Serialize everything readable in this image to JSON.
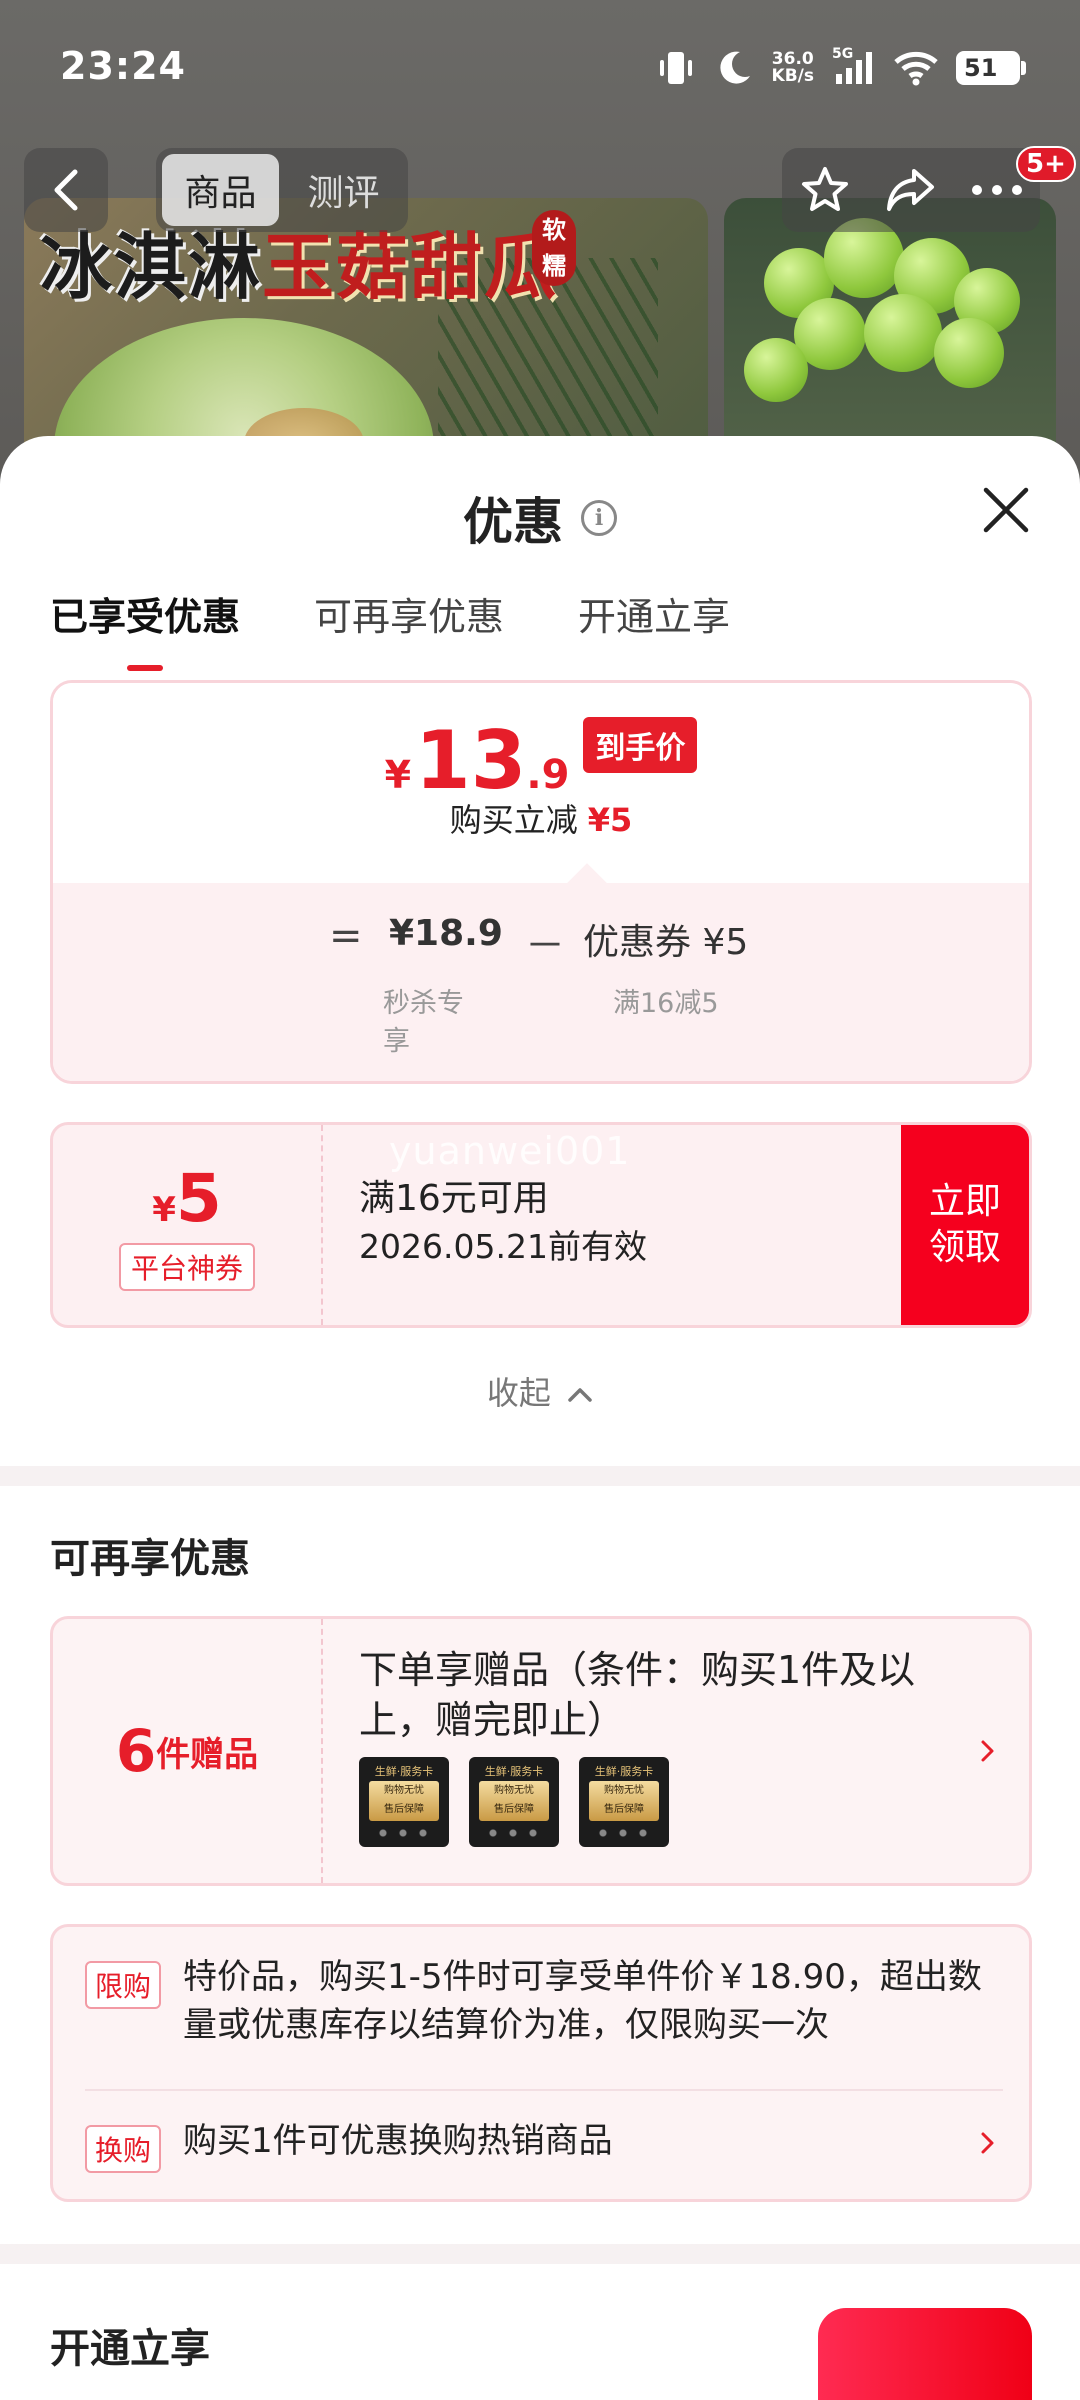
{
  "status": {
    "time": "23:24",
    "net_speed_value": "36.0",
    "net_speed_unit": "KB/s",
    "signal_label": "5G",
    "battery": "51"
  },
  "product_page": {
    "banner_black": "冰淇淋",
    "banner_red": "玉菇甜瓜",
    "banner_badge": "软糯",
    "nav_tabs": [
      "商品",
      "测评"
    ],
    "badge_count": "5+",
    "icons": [
      "back-icon",
      "star-icon",
      "share-icon",
      "more-icon"
    ]
  },
  "sheet": {
    "title": "优惠",
    "tabs": [
      "已享受优惠",
      "可再享优惠",
      "开通立享"
    ],
    "active_tab": 0
  },
  "price_card": {
    "currency": "¥",
    "price_int": "13",
    "price_dec": ".9",
    "price_tag": "到手价",
    "reduce_label": "购买立减",
    "reduce_value": "¥5",
    "eq": "=",
    "original_price": "¥18.9",
    "minus": "－",
    "coupon_label": "优惠券 ¥5",
    "original_sub": "秒杀专享",
    "coupon_sub": "满16减5"
  },
  "coupon": {
    "currency": "¥",
    "amount": "5",
    "type": "平台神券",
    "condition": "满16元可用",
    "validity": "2026.05.21前有效",
    "button": "立即领取",
    "watermark": "yuanwei001"
  },
  "collapse_label": "收起",
  "more_offers": {
    "title": "可再享优惠",
    "gift": {
      "count": "6",
      "unit": "件赠品",
      "text": "下单享赠品（条件：购买1件及以上，赠完即止）",
      "thumb_line1": "生鲜·服务卡",
      "thumb_line2": "购物无忧",
      "thumb_line3": "售后保障"
    },
    "rules": [
      {
        "tag": "限购",
        "text": "特价品，购买1-5件时可享受单件价￥18.90，超出数量或优惠库存以结算价为准，仅限购买一次"
      },
      {
        "tag": "换购",
        "text": "购买1件可优惠换购热销商品"
      }
    ]
  },
  "open_section": {
    "title": "开通立享"
  },
  "colors": {
    "accent_red": "#e61e2a",
    "coupon_btn": "#f5001e",
    "card_border": "#f8d4da",
    "card_bg": "#fdf0f2"
  }
}
